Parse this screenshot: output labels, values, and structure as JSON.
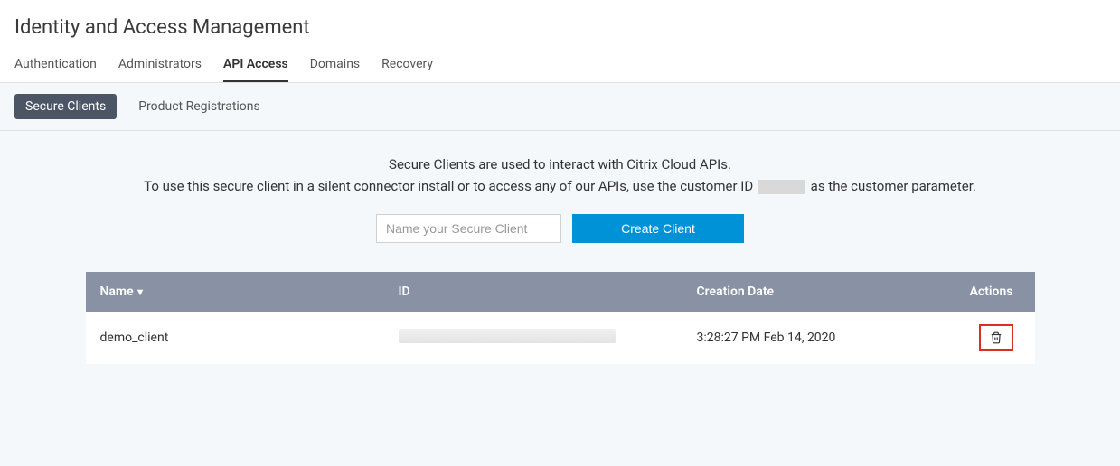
{
  "page": {
    "title": "Identity and Access Management"
  },
  "tabs": [
    {
      "label": "Authentication",
      "active": false
    },
    {
      "label": "Administrators",
      "active": false
    },
    {
      "label": "API Access",
      "active": true
    },
    {
      "label": "Domains",
      "active": false
    },
    {
      "label": "Recovery",
      "active": false
    }
  ],
  "subtabs": [
    {
      "label": "Secure Clients",
      "active": true
    },
    {
      "label": "Product Registrations",
      "active": false
    }
  ],
  "intro": {
    "line1": "Secure Clients are used to interact with Citrix Cloud APIs.",
    "line2_prefix": "To use this secure client in a silent connector install or to access any of our APIs, use the customer ID",
    "line2_suffix": "as the customer parameter."
  },
  "create": {
    "placeholder": "Name your Secure Client",
    "button_label": "Create Client"
  },
  "table": {
    "columns": {
      "name": "Name",
      "id": "ID",
      "date": "Creation Date",
      "actions": "Actions"
    },
    "rows": [
      {
        "name": "demo_client",
        "id": "",
        "date": "3:28:27 PM Feb 14, 2020"
      }
    ]
  }
}
